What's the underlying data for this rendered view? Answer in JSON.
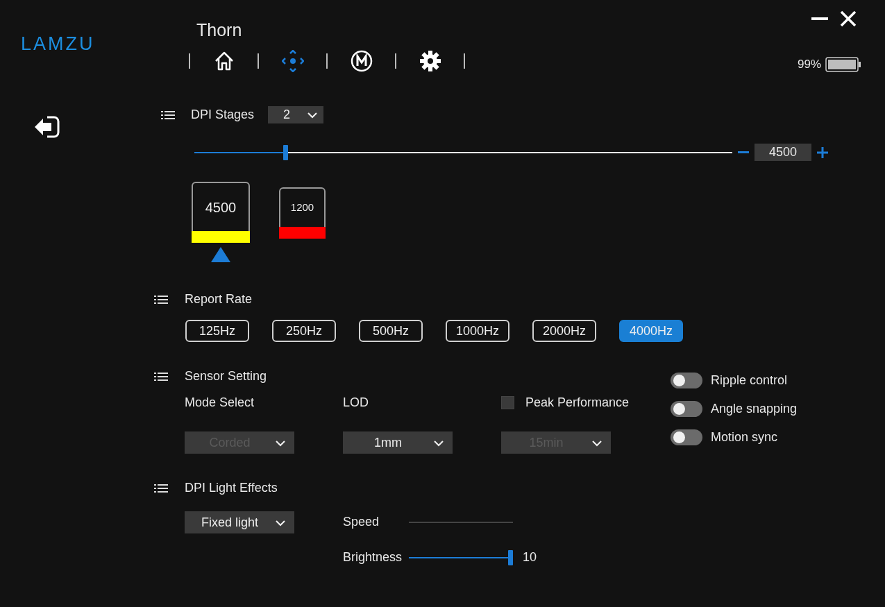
{
  "logo": "LAMZU",
  "device_name": "Thorn",
  "nav_tabs": [
    {
      "kind": "home",
      "selected": false
    },
    {
      "kind": "dpi",
      "selected": true
    },
    {
      "kind": "macro",
      "selected": false
    },
    {
      "kind": "settings",
      "selected": false
    }
  ],
  "battery": {
    "reading": "99%"
  },
  "dpi_stages": {
    "title": "DPI Stages",
    "count": "2",
    "slider": {
      "level": 0.174
    },
    "value": "4500",
    "stages": [
      {
        "value": "4500",
        "color": "#ffff00",
        "selected": true
      },
      {
        "value": "1200",
        "color": "#ff0000",
        "selected": false
      }
    ]
  },
  "report_rate": {
    "title": "Report Rate",
    "options": [
      {
        "label": "125Hz",
        "selected": false
      },
      {
        "label": "250Hz",
        "selected": false
      },
      {
        "label": "500Hz",
        "selected": false
      },
      {
        "label": "1000Hz",
        "selected": false
      },
      {
        "label": "2000Hz",
        "selected": false
      },
      {
        "label": "4000Hz",
        "selected": true
      }
    ]
  },
  "sensor_setting": {
    "title": "Sensor Setting",
    "mode_select": {
      "label": "Mode Select",
      "value": "Corded",
      "disabled": true
    },
    "lod": {
      "label": "LOD",
      "value": "1mm",
      "disabled": false
    },
    "peak_performance": {
      "label": "Peak Performance",
      "checked": false,
      "timer": "15min",
      "timer_disabled": true
    },
    "toggles": [
      {
        "label": "Ripple control",
        "on": false
      },
      {
        "label": "Angle snapping",
        "on": false
      },
      {
        "label": "Motion sync",
        "on": false
      }
    ]
  },
  "dpi_light_effects": {
    "title": "DPI Light Effects",
    "effect": "Fixed light",
    "speed": {
      "label": "Speed",
      "disabled": true
    },
    "brightness": {
      "label": "Brightness",
      "level": 1.0,
      "reading": "10"
    }
  }
}
